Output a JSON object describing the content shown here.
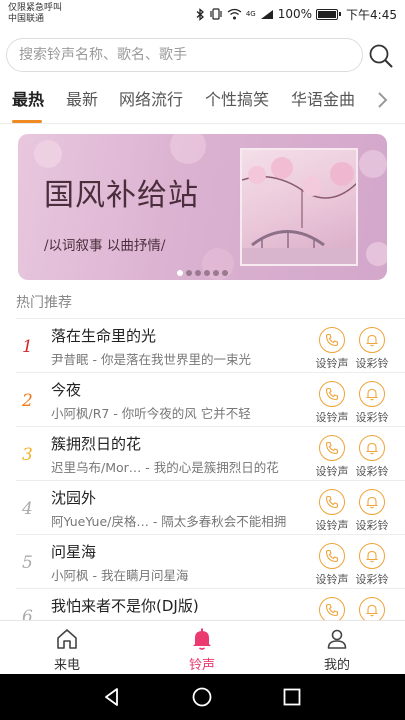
{
  "status_bar": {
    "carrier_line1": "仅限紧急呼叫",
    "carrier_line2": "中国联通",
    "network": "4G",
    "battery": "100%",
    "time": "下午4:45"
  },
  "search": {
    "placeholder": "搜索铃声名称、歌名、歌手"
  },
  "tabs": [
    "最热",
    "最新",
    "网络流行",
    "个性搞笑",
    "华语金曲"
  ],
  "banner": {
    "title": "国风补给站",
    "subtitle": "/以词叙事 以曲抒情/",
    "active_dot": 1,
    "dot_count": 6
  },
  "section_title": "热门推荐",
  "action_labels": {
    "ringtone": "设铃声",
    "crbt": "设彩铃"
  },
  "songs": [
    {
      "rank": "1",
      "title": "落在生命里的光",
      "subtitle": "尹昔眠 - 你是落在我世界里的一束光",
      "rank_color": "#d42a2a"
    },
    {
      "rank": "2",
      "title": "今夜",
      "subtitle": "小阿枫/R7 - 你听今夜的风 它并不轻",
      "rank_color": "#ee7a1e"
    },
    {
      "rank": "3",
      "title": "簇拥烈日的花",
      "subtitle": "迟里乌布/Mor… - 我的心是簇拥烈日的花",
      "rank_color": "#f2b22a"
    },
    {
      "rank": "4",
      "title": "沈园外",
      "subtitle": "阿YueYue/戾格… - 隔太多春秋会不能相拥",
      "rank_color": "#aaaaaa"
    },
    {
      "rank": "5",
      "title": "问星海",
      "subtitle": "小阿枫 - 我在瞒月问星海",
      "rank_color": "#aaaaaa"
    },
    {
      "rank": "6",
      "title": "我怕来者不是你(DJ版)",
      "subtitle": "",
      "rank_color": "#aaaaaa"
    }
  ],
  "bottom_nav": {
    "items": [
      {
        "label": "来电",
        "icon": "home-icon"
      },
      {
        "label": "铃声",
        "icon": "bell-icon",
        "active": true
      },
      {
        "label": "我的",
        "icon": "profile-icon"
      }
    ]
  },
  "colors": {
    "accent_orange": "#f08a24",
    "icon_orange": "#f0a43a",
    "active_pink": "#ea3a6f"
  }
}
